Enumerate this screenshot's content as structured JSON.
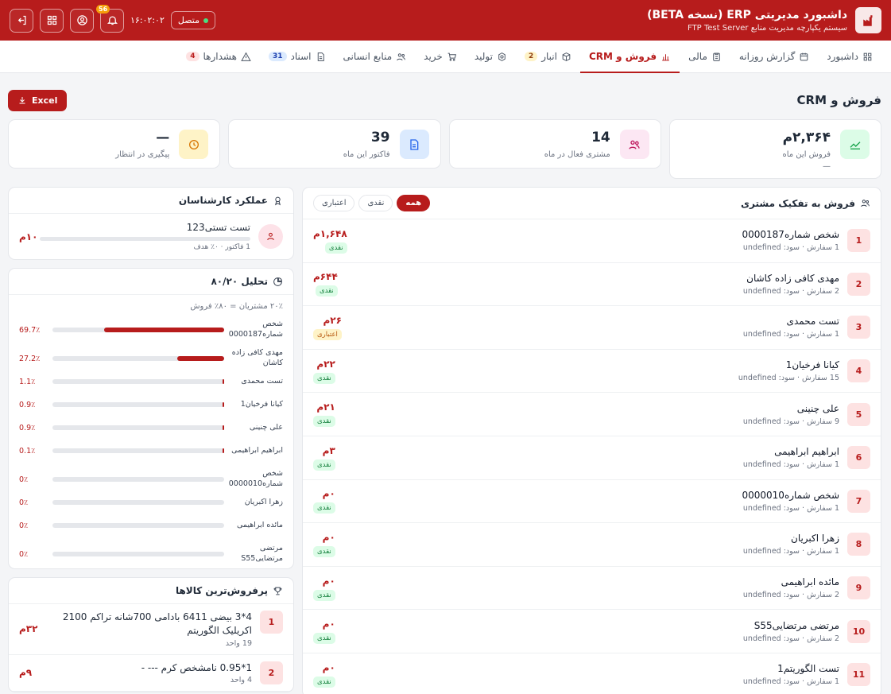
{
  "app": {
    "title": "داشبورد مدیریتی ERP (نسخه BETA)",
    "subtitle": "سیستم یکپارچه مدیریت منابع FTP Test Server",
    "status": "متصل",
    "time": "۱۶:۰۲:۰۲",
    "notif_count": "56",
    "accent": "#b71c1c"
  },
  "nav": [
    {
      "label": "داشبورد",
      "icon": "grid-icon"
    },
    {
      "label": "گزارش روزانه",
      "icon": "calendar-icon"
    },
    {
      "label": "مالی",
      "icon": "clipboard-icon"
    },
    {
      "label": "فروش و CRM",
      "icon": "bar-chart-icon",
      "active": true
    },
    {
      "label": "انبار",
      "icon": "box-icon",
      "badge": "2"
    },
    {
      "label": "تولید",
      "icon": "gear-icon"
    },
    {
      "label": "خرید",
      "icon": "cart-icon"
    },
    {
      "label": "منابع انسانی",
      "icon": "users-icon"
    },
    {
      "label": "اسناد",
      "icon": "document-icon",
      "badge": "31"
    },
    {
      "label": "هشدارها",
      "icon": "warning-icon",
      "badge": "4"
    }
  ],
  "page": {
    "title": "فروش و CRM",
    "excel_label": "Excel"
  },
  "kpis": [
    {
      "value": "۲,۳۶۴م",
      "label": "فروش این ماه",
      "sub": "—"
    },
    {
      "value": "14",
      "label": "مشتری فعال در ماه"
    },
    {
      "value": "39",
      "label": "فاکتور این ماه"
    },
    {
      "value": "—",
      "label": "پیگیری در انتظار"
    }
  ],
  "customers": {
    "title": "فروش به تفکیک مشتری",
    "filters": [
      "همه",
      "نقدی",
      "اعتباری"
    ],
    "rows": [
      {
        "rank": "1",
        "name": "شخص شماره0000187",
        "meta": "1 سفارش · سود: undefined",
        "amount": "۱,۶۴۸م",
        "tag": "نقدی"
      },
      {
        "rank": "2",
        "name": "مهدی کافی زاده کاشان",
        "meta": "2 سفارش · سود: undefined",
        "amount": "۶۴۴م",
        "tag": "نقدی"
      },
      {
        "rank": "3",
        "name": "تست محمدی",
        "meta": "1 سفارش · سود: undefined",
        "amount": "۲۶م",
        "tag": "اعتباری"
      },
      {
        "rank": "4",
        "name": "کیانا فرخیان1",
        "meta": "15 سفارش · سود: undefined",
        "amount": "۲۲م",
        "tag": "نقدی"
      },
      {
        "rank": "5",
        "name": "علی چنینی",
        "meta": "9 سفارش · سود: undefined",
        "amount": "۲۱م",
        "tag": "نقدی"
      },
      {
        "rank": "6",
        "name": "ابراهیم ابراهیمی",
        "meta": "1 سفارش · سود: undefined",
        "amount": "۳م",
        "tag": "نقدی"
      },
      {
        "rank": "7",
        "name": "شخص شماره0000010",
        "meta": "1 سفارش · سود: undefined",
        "amount": "۰م",
        "tag": "نقدی"
      },
      {
        "rank": "8",
        "name": "زهرا اکبریان",
        "meta": "1 سفارش · سود: undefined",
        "amount": "۰م",
        "tag": "نقدی"
      },
      {
        "rank": "9",
        "name": "مائده ابراهیمی",
        "meta": "2 سفارش · سود: undefined",
        "amount": "۰م",
        "tag": "نقدی"
      },
      {
        "rank": "10",
        "name": "مرتضی مرتضاییS55",
        "meta": "2 سفارش · سود: undefined",
        "amount": "۰م",
        "tag": "نقدی"
      },
      {
        "rank": "11",
        "name": "تست الگوریتم1",
        "meta": "1 سفارش · سود: undefined",
        "amount": "۰م",
        "tag": "نقدی"
      }
    ]
  },
  "experts": {
    "title": "عملکرد کارشناسان",
    "items": [
      {
        "name": "تست تستی123",
        "meta": "1 فاکتور · ۰٪ هدف",
        "amount": "۱۰م",
        "progress": 0
      }
    ]
  },
  "pareto": {
    "title": "تحلیل ۸۰/۲۰",
    "subtitle": "۲۰٪ مشتریان = ۸۰٪ فروش",
    "rows": [
      {
        "name": "شخص شماره0000187",
        "pct": "69.7٪",
        "value": 69.7
      },
      {
        "name": "مهدی کافی زاده کاشان",
        "pct": "27.2٪",
        "value": 27.2
      },
      {
        "name": "تست محمدی",
        "pct": "1.1٪",
        "value": 1.1
      },
      {
        "name": "کیانا فرخیان1",
        "pct": "0.9٪",
        "value": 0.9
      },
      {
        "name": "علی چنینی",
        "pct": "0.9٪",
        "value": 0.9
      },
      {
        "name": "ابراهیم ابراهیمی",
        "pct": "0.1٪",
        "value": 0.1
      },
      {
        "name": "شخص شماره0000010",
        "pct": "0٪",
        "value": 0
      },
      {
        "name": "زهرا اکبریان",
        "pct": "0٪",
        "value": 0
      },
      {
        "name": "مائده ابراهیمی",
        "pct": "0٪",
        "value": 0
      },
      {
        "name": "مرتضی مرتضاییS55",
        "pct": "0٪",
        "value": 0
      }
    ]
  },
  "products": {
    "title": "پرفروش‌ترین کالاها",
    "items": [
      {
        "rank": "1",
        "name": "4*3 بیضی 6411 بادامی 700شانه تراکم 2100 اکریلیک الگوریتم",
        "meta": "19 واحد",
        "amount": "۳۲م"
      },
      {
        "rank": "2",
        "name": "1*0.95 نامشخص کرم --- -",
        "meta": "4 واحد",
        "amount": "۹م"
      }
    ]
  }
}
